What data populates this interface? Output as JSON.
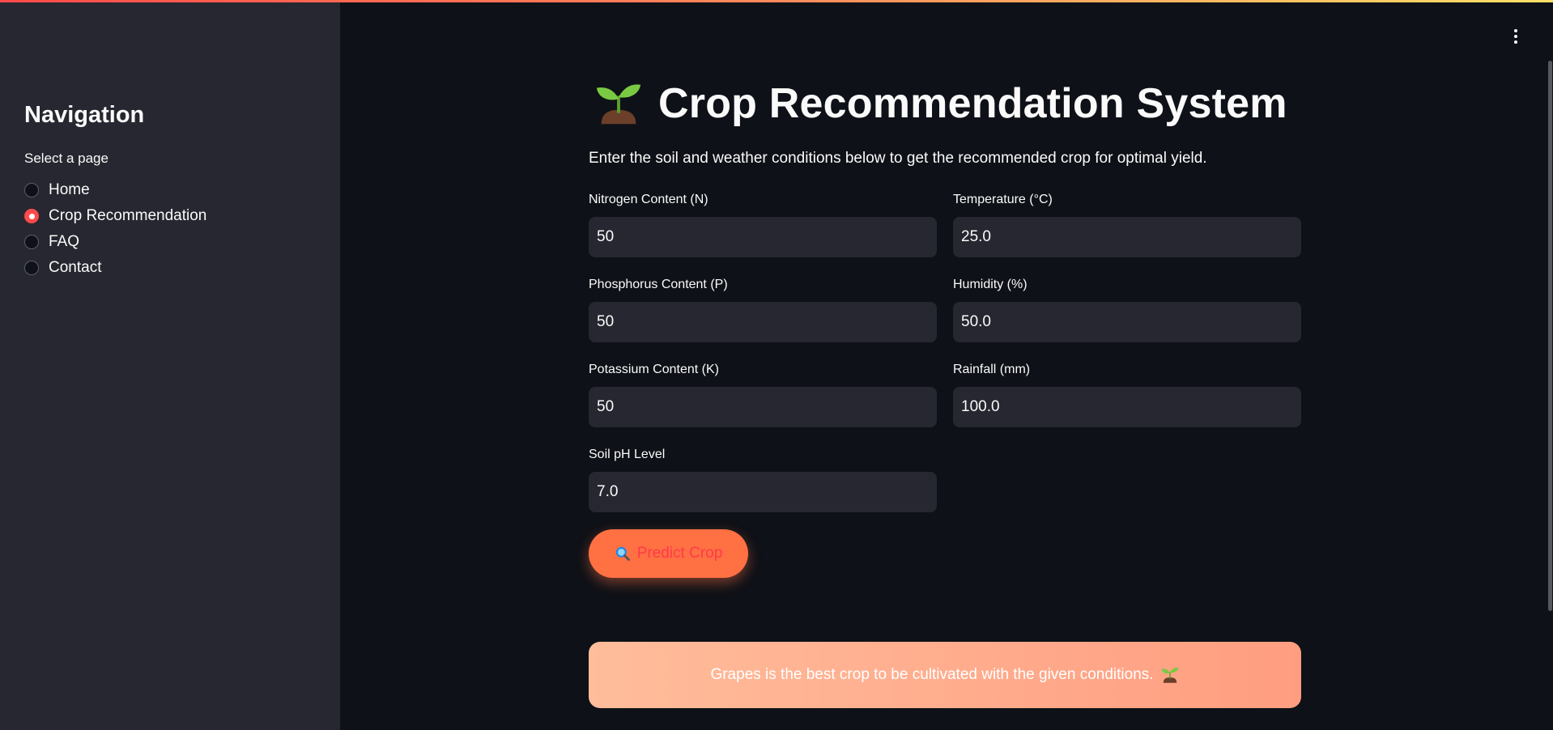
{
  "sidebar": {
    "heading": "Navigation",
    "radio_label": "Select a page",
    "options": [
      {
        "label": "Home",
        "selected": false
      },
      {
        "label": "Crop Recommendation",
        "selected": true
      },
      {
        "label": "FAQ",
        "selected": false
      },
      {
        "label": "Contact",
        "selected": false
      }
    ]
  },
  "main": {
    "title_icon": "sprout-icon",
    "title": "Crop Recommendation System",
    "subtitle": "Enter the soil and weather conditions below to get the recommended crop for optimal yield.",
    "fields": {
      "nitrogen": {
        "label": "Nitrogen Content (N)",
        "value": "50"
      },
      "temperature": {
        "label": "Temperature (°C)",
        "value": "25.0"
      },
      "phosphorus": {
        "label": "Phosphorus Content (P)",
        "value": "50"
      },
      "humidity": {
        "label": "Humidity (%)",
        "value": "50.0"
      },
      "potassium": {
        "label": "Potassium Content (K)",
        "value": "50"
      },
      "rainfall": {
        "label": "Rainfall (mm)",
        "value": "100.0"
      },
      "ph": {
        "label": "Soil pH Level",
        "value": "7.0"
      }
    },
    "predict_button": {
      "icon": "magnifier-icon",
      "label": "Predict Crop"
    },
    "result": {
      "text": "Grapes is the best crop to be cultivated with the given conditions.",
      "icon": "sprout-icon"
    }
  },
  "colors": {
    "background": "#0e1117",
    "sidebar": "#262730",
    "input": "#262730",
    "accent": "#ff4b4b",
    "button": "#ff7043",
    "result_gradient_start": "#ffbd9b",
    "result_gradient_end": "#ff9d80"
  }
}
